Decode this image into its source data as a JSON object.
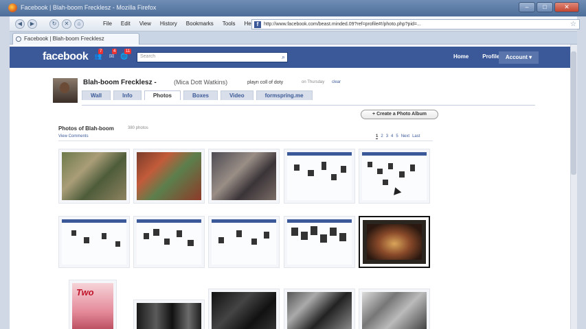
{
  "window": {
    "title": "Facebook | Blah-boom Frecklesz - Mozilla Firefox"
  },
  "menu": [
    "File",
    "Edit",
    "View",
    "History",
    "Bookmarks",
    "Tools",
    "Help"
  ],
  "url": "http://www.facebook.com/beast.minded.09?ref=profile#!/photo.php?pid=...",
  "tab": {
    "label": "Facebook | Blah-boom Frecklesz"
  },
  "fb": {
    "logo": "facebook",
    "search_placeholder": "Search",
    "jewels": [
      {
        "icon": "friends-icon",
        "count": "7"
      },
      {
        "icon": "messages-icon",
        "count": "4"
      },
      {
        "icon": "notifications-icon",
        "count": "11"
      }
    ],
    "nav": [
      "Home",
      "Profile"
    ],
    "account": "Account ▾"
  },
  "profile": {
    "name": "Blah-boom Frecklesz -",
    "alt_name": "(Mica Dott Watkins)",
    "status": "playn coll of doty",
    "status_time": "on Thursday",
    "status_clear": "clear",
    "tabs": [
      "Wall",
      "Info",
      "Photos",
      "Boxes",
      "Video",
      "formspring.me"
    ],
    "active_tab": "Photos"
  },
  "photos": {
    "create_album": "+ Create a Photo Album",
    "title": "Photos of Blah-boom",
    "count": "380 photos",
    "view_comments": "View Comments",
    "pager": [
      "1",
      "2",
      "3",
      "4",
      "5",
      "Next",
      "Last"
    ]
  },
  "colors": {
    "fb_blue": "#3b5998",
    "tab_bg": "#d8dfea"
  }
}
